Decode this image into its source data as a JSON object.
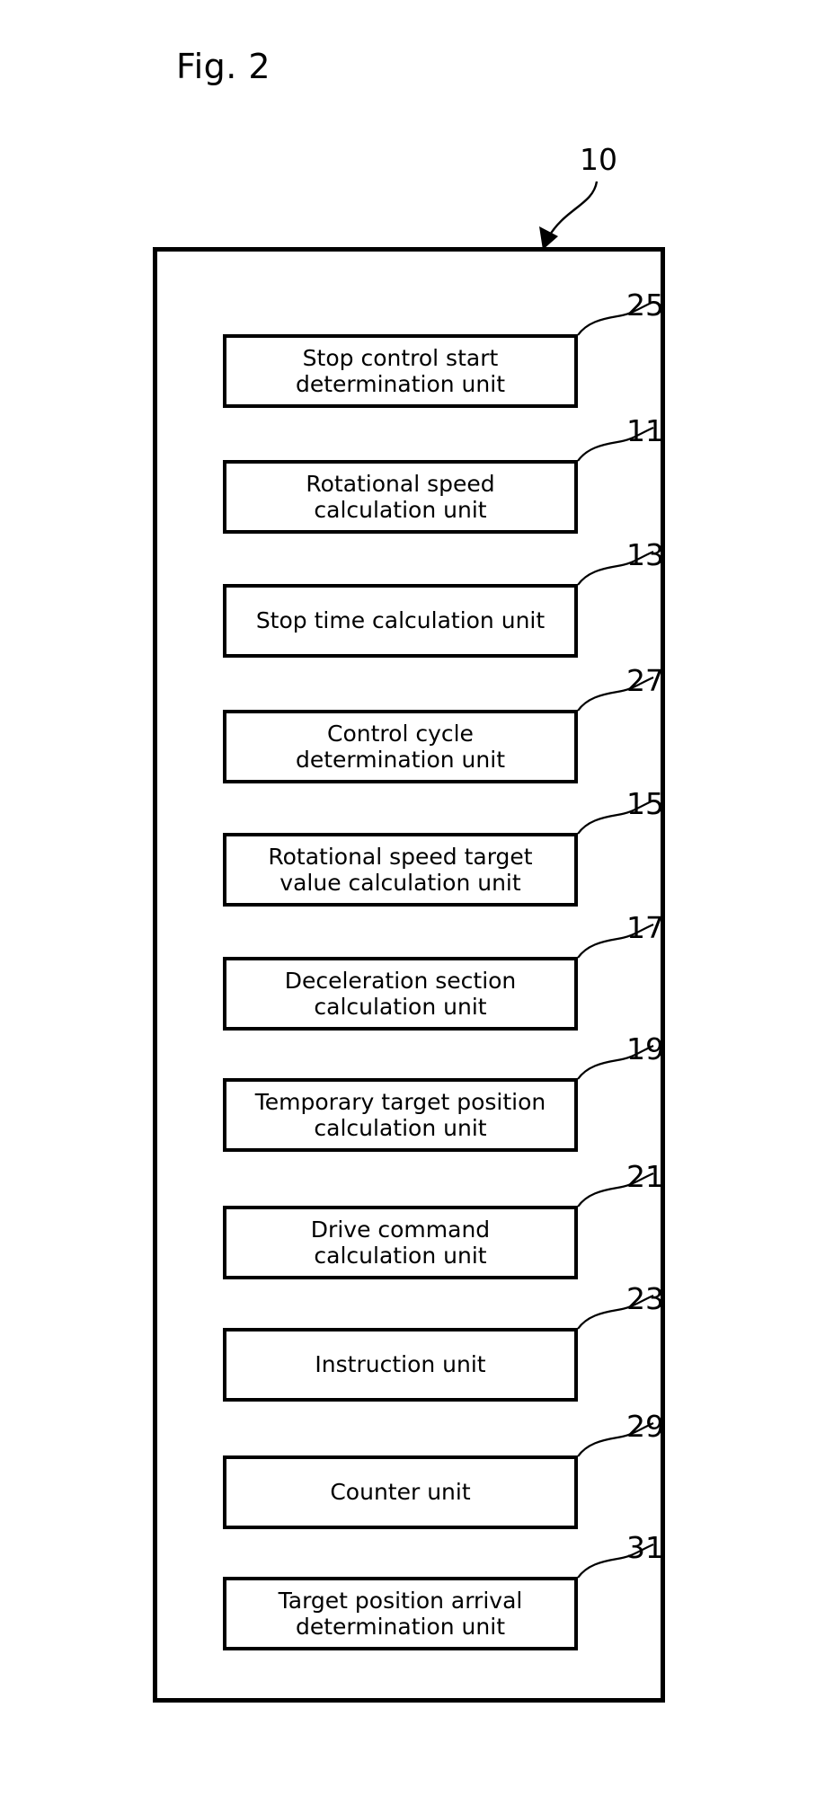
{
  "figure": {
    "title": "Fig. 2",
    "system_reference": "10",
    "line_color": "#000000",
    "background_color": "#ffffff"
  },
  "diagram": {
    "type": "block-diagram",
    "outer_block_label": "10",
    "units": [
      {
        "reference": "25",
        "label": "Stop control start\ndetermination unit"
      },
      {
        "reference": "11",
        "label": "Rotational speed\ncalculation unit"
      },
      {
        "reference": "13",
        "label": "Stop time calculation unit"
      },
      {
        "reference": "27",
        "label": "Control cycle\ndetermination unit"
      },
      {
        "reference": "15",
        "label": "Rotational speed target\nvalue calculation unit"
      },
      {
        "reference": "17",
        "label": "Deceleration section\ncalculation unit"
      },
      {
        "reference": "19",
        "label": "Temporary target position\ncalculation unit"
      },
      {
        "reference": "21",
        "label": "Drive command\ncalculation unit"
      },
      {
        "reference": "23",
        "label": "Instruction unit"
      },
      {
        "reference": "29",
        "label": "Counter unit"
      },
      {
        "reference": "31",
        "label": "Target position arrival\ndetermination unit"
      }
    ]
  }
}
